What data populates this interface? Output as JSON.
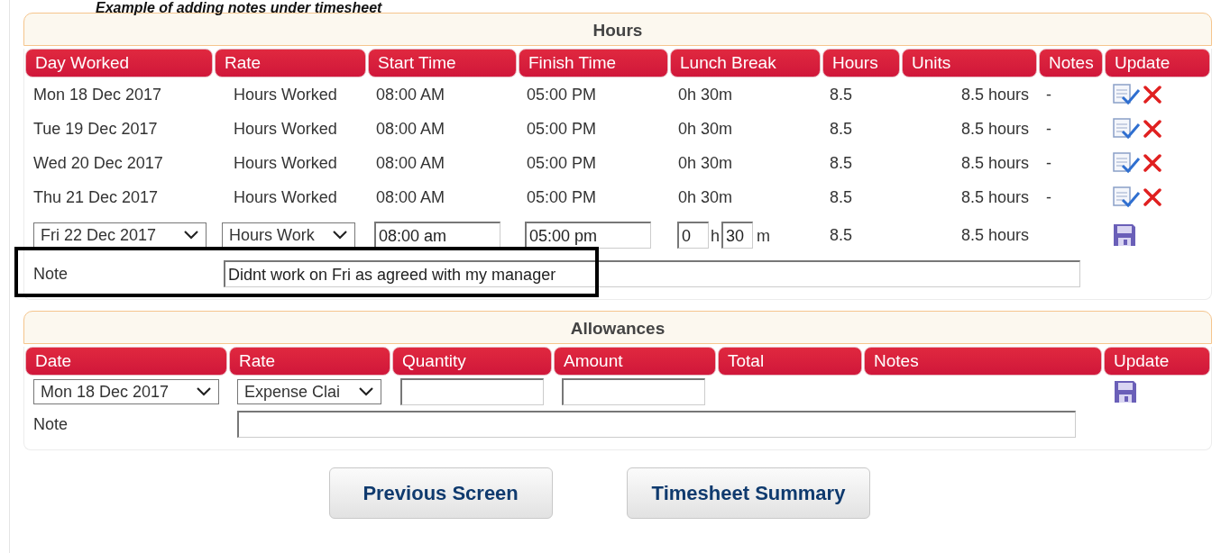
{
  "caption": "Example of adding notes under timesheet",
  "hours": {
    "title": "Hours",
    "columns": [
      "Day Worked",
      "Rate",
      "Start Time",
      "Finish Time",
      "Lunch Break",
      "Hours",
      "Units",
      "Notes",
      "Update"
    ],
    "rows": [
      {
        "day": "Mon 18 Dec 2017",
        "rate": "Hours Worked",
        "start": "08:00 AM",
        "finish": "05:00 PM",
        "lunch": "0h 30m",
        "hours": "8.5",
        "units": "8.5 hours",
        "notes": "-"
      },
      {
        "day": "Tue 19 Dec 2017",
        "rate": "Hours Worked",
        "start": "08:00 AM",
        "finish": "05:00 PM",
        "lunch": "0h 30m",
        "hours": "8.5",
        "units": "8.5 hours",
        "notes": "-"
      },
      {
        "day": "Wed 20 Dec 2017",
        "rate": "Hours Worked",
        "start": "08:00 AM",
        "finish": "05:00 PM",
        "lunch": "0h 30m",
        "hours": "8.5",
        "units": "8.5 hours",
        "notes": "-"
      },
      {
        "day": "Thu 21 Dec 2017",
        "rate": "Hours Worked",
        "start": "08:00 AM",
        "finish": "05:00 PM",
        "lunch": "0h 30m",
        "hours": "8.5",
        "units": "8.5 hours",
        "notes": "-"
      }
    ],
    "edit_row": {
      "day": "Fri 22 Dec 2017",
      "rate": "Hours Work",
      "start": "08:00 am",
      "finish": "05:00 pm",
      "lunch_hours": "0",
      "hours_unit": "h",
      "lunch_minutes": "30",
      "minutes_unit": "m",
      "hours": "8.5",
      "units": "8.5 hours"
    },
    "note": {
      "label": "Note",
      "value": "Didnt work on Fri as agreed with my manager",
      "highlighted": true
    }
  },
  "allowances": {
    "title": "Allowances",
    "columns": [
      "Date",
      "Rate",
      "Quantity",
      "Amount",
      "Total",
      "Notes",
      "Update"
    ],
    "edit_row": {
      "date": "Mon 18 Dec 2017",
      "rate": "Expense Clai"
    },
    "note": {
      "label": "Note"
    }
  },
  "buttons": [
    "Previous Screen",
    "Timesheet Summary"
  ]
}
